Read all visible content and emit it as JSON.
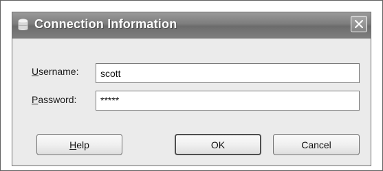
{
  "dialog": {
    "title": "Connection Information",
    "title_icon": "database-icon",
    "close_icon": "close-icon"
  },
  "username": {
    "label_mnemonic": "U",
    "label_rest": "sername:",
    "value": "scott"
  },
  "password": {
    "label_mnemonic": "P",
    "label_rest": "assword:",
    "value": "*****"
  },
  "buttons": {
    "help_mnemonic": "H",
    "help_rest": "elp",
    "ok_label": "OK",
    "cancel_label": "Cancel"
  }
}
